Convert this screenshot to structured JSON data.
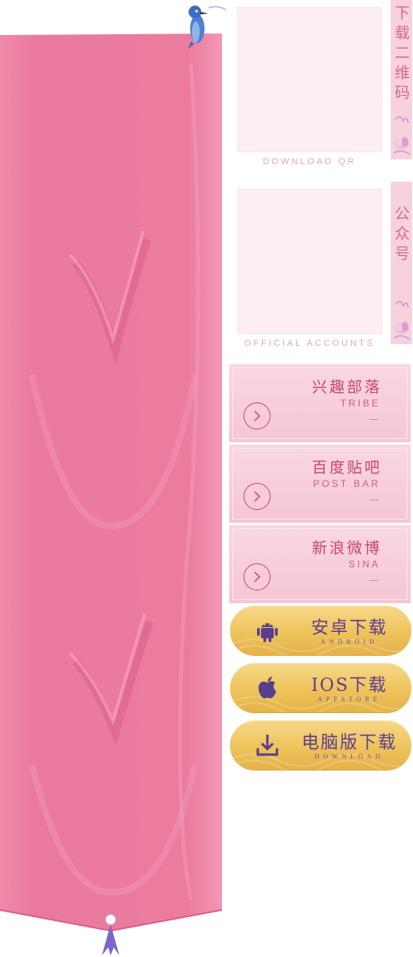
{
  "qr_download": {
    "label": "下载二维码",
    "caption": "DOWNLOAD QR"
  },
  "qr_official": {
    "label": "公众号",
    "caption": "OFFICIAL ACCOUNTS"
  },
  "cards": [
    {
      "title": "兴趣部落",
      "subtitle": "TRIBE",
      "dash": "—",
      "icon": "chevron-right-icon"
    },
    {
      "title": "百度贴吧",
      "subtitle": "POST BAR",
      "dash": "—",
      "icon": "chevron-right-icon"
    },
    {
      "title": "新浪微博",
      "subtitle": "SINA",
      "dash": "—",
      "icon": "chevron-right-icon"
    }
  ],
  "downloads": [
    {
      "title": "安卓下载",
      "subtitle": "ANDROID",
      "icon": "android-icon"
    },
    {
      "title": "IOS下载",
      "subtitle": "APPSTORE",
      "icon": "apple-icon"
    },
    {
      "title": "电脑版下载",
      "subtitle": "DOWNLOAD",
      "icon": "download-icon"
    }
  ],
  "colors": {
    "banner": "#ea7a9d",
    "card": "#f5c6d3",
    "accent": "#c7466e",
    "button_gold": "#eec35b",
    "button_text": "#5a3d8f"
  }
}
